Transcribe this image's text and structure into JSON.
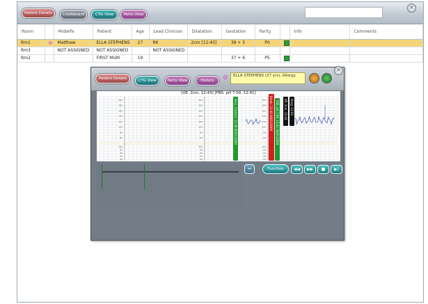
{
  "toolbar": {
    "tabs": [
      {
        "label": "Patient Details"
      },
      {
        "label": "Chalkboard"
      },
      {
        "label": "CTG View"
      },
      {
        "label": "Parto View"
      }
    ],
    "search_value": ""
  },
  "board": {
    "columns": [
      "Room",
      "",
      "Midwife",
      "Patient",
      "Age",
      "Lead Clinician",
      "Dilatation",
      "Gestation",
      "Parity",
      "",
      "Info",
      "Comments"
    ],
    "rows": [
      {
        "room": "Rm1",
        "icon": "flower-icon",
        "midwife": "Matthew",
        "patient": "ELLA STEPHENS",
        "age": "27",
        "lead": "RK",
        "dilatation": "2cm [12:43]",
        "gestation": "39 + 5",
        "parity": "P0",
        "flag": true,
        "info": "",
        "comments": ""
      },
      {
        "room": "Rm3",
        "icon": "",
        "midwife": "NOT ASSIGNED",
        "patient": "NOT ASSIGNED",
        "age": "",
        "lead": "NOT ASSIGNED",
        "dilatation": "",
        "gestation": "",
        "parity": "",
        "flag": false,
        "info": "",
        "comments": ""
      },
      {
        "room": "Rm2",
        "icon": "",
        "midwife": "",
        "patient": "FIRST MUM",
        "age": "19",
        "lead": "",
        "dilatation": "",
        "gestation": "37 + 6",
        "parity": "P5",
        "flag": true,
        "info": "",
        "comments": ""
      }
    ]
  },
  "ctg": {
    "tabs": [
      {
        "label": "Patient Details"
      },
      {
        "label": "CTG View"
      },
      {
        "label": "Parto View"
      },
      {
        "label": "History"
      }
    ],
    "patient_info": "ELLA STEPHENS (27 yrs), Allergy",
    "plot_title": "[VE: 2cm, 12:43] [FBS: pH 7.09, 12:41]",
    "function_label": "Function",
    "fhr_ticks": [
      "200",
      "180",
      "160",
      "140",
      "120",
      "100",
      "80",
      "60"
    ],
    "toco_ticks": [
      "100",
      "80",
      "60",
      "40",
      "20"
    ],
    "markers": [
      {
        "text": "Rm1, Contact: 12:38 06/01/2009",
        "color": "#1f9a2e"
      },
      {
        "text": "Break: 12:40 06/01/2009",
        "color": "#d0201c"
      },
      {
        "text": "FBS: pH 7.09, 12:41 06/01/2009",
        "color": "#1f9a2e"
      },
      {
        "text": "VE: 2cm, 12:43",
        "color": "#111111"
      },
      {
        "text": "Drug: 12:43",
        "color": "#111111"
      }
    ]
  },
  "colors": {
    "highlight_row": "#f5d57a",
    "fhr_trace": "#3a4fa8",
    "grid": "#c8cdd2",
    "marker_green": "#1f9a2e",
    "marker_red": "#d0201c"
  }
}
